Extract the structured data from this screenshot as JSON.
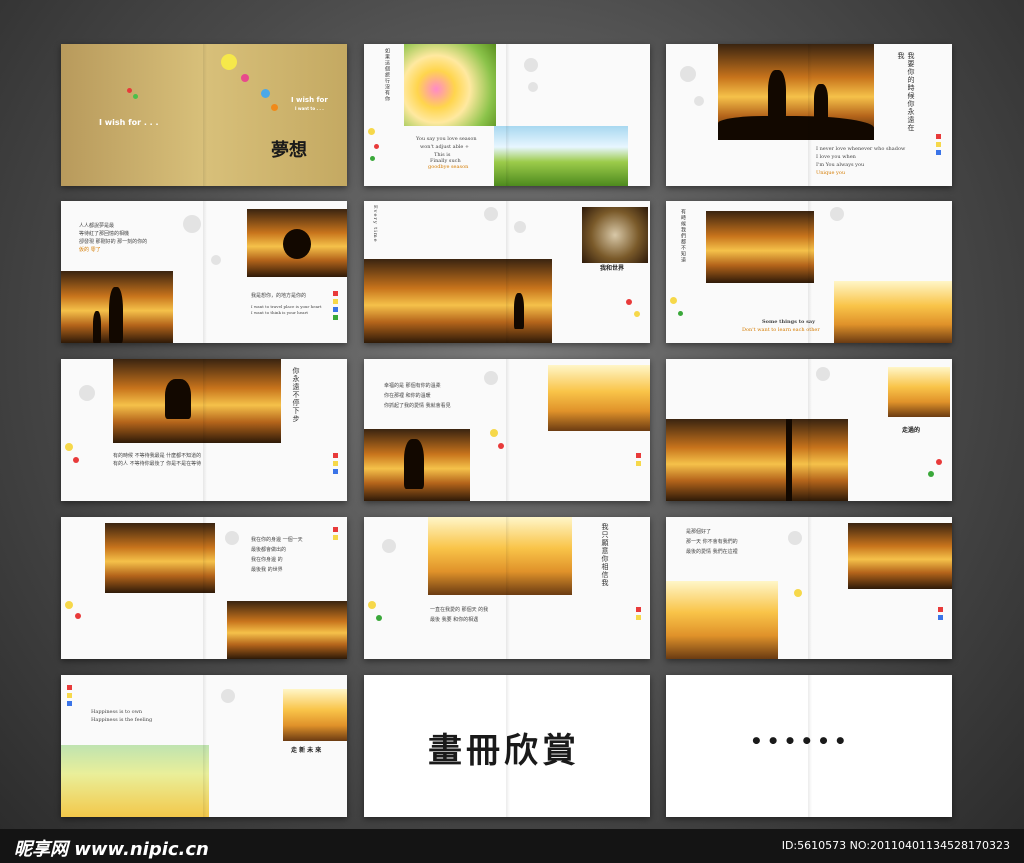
{
  "spreads": {
    "s1": {
      "wish_left": "I wish for . . .",
      "wish_right_1": "I wish for",
      "wish_right_2": "I want to . . .",
      "title": "夢想"
    },
    "s2": {
      "vert": "如果這個旅行沒有你",
      "line1": "You say you love season",
      "line2": "won't adjust able +",
      "line3": "This is",
      "line4": "Finally such",
      "line5": "goodbye season"
    },
    "s3": {
      "vert": "我要你的時候你永遠在我",
      "line1": "I never love whenever who shadow",
      "line2": "I love you when",
      "line3": "I'm You always you",
      "line4": "Unique you"
    },
    "s4": {
      "line1": "人人都說夢是最",
      "line2": "等待紅了那回憶的相機",
      "line3": "卻發現 那剛好的 那一刻的你的",
      "line4": "仮的 零了",
      "line5": "我是想你，的地方是你的",
      "line6": "I want to travel place is your heart",
      "line7": "I want to think is your heart"
    },
    "s5": {
      "vert": "Every time",
      "label": "我和世界"
    },
    "s6": {
      "vert": "有時候我們都不知道",
      "line1": "Some things to say",
      "line2": "Don't want to learn each other"
    },
    "s7": {
      "vert": "你永遠不停下步",
      "line1": "有的時候 不等待我最是 什麼都不知道的",
      "line2": "有的人 不等待你最後了 你是不是在等待"
    },
    "s8": {
      "line1": "幸福的是 那個有你的溫柔",
      "line2": "你在那裡 和你的溫暖",
      "line3": "你抓起了我的愛情 我就會看見"
    },
    "s9": {
      "label": "走過的"
    },
    "s10": {
      "line1": "我在你的身邊 一個一天",
      "line2": "最後都會做出的",
      "line3": "我在你身邊 的",
      "line4": "最後我 的世界"
    },
    "s11": {
      "vert": "我只願意你相信我",
      "line1": "一直在我愛的 那個天 的我",
      "line2": "最後 我要 和你的相遇"
    },
    "s12": {
      "line1": "是那個好了",
      "line2": "那一天 你不會有我們的",
      "line3": "最後的愛情 我們在這裡"
    },
    "s13": {
      "line1": "Happiness is to own",
      "line2": "Happiness is the feeling",
      "label": "走 新 未 來"
    },
    "s14": {
      "title": "畫冊欣賞"
    },
    "s15": {
      "title": "••••••"
    }
  },
  "footer": {
    "logo": "昵享网 www.nipic.cn",
    "id": "ID:5610573 NO:20110401134528170323"
  }
}
